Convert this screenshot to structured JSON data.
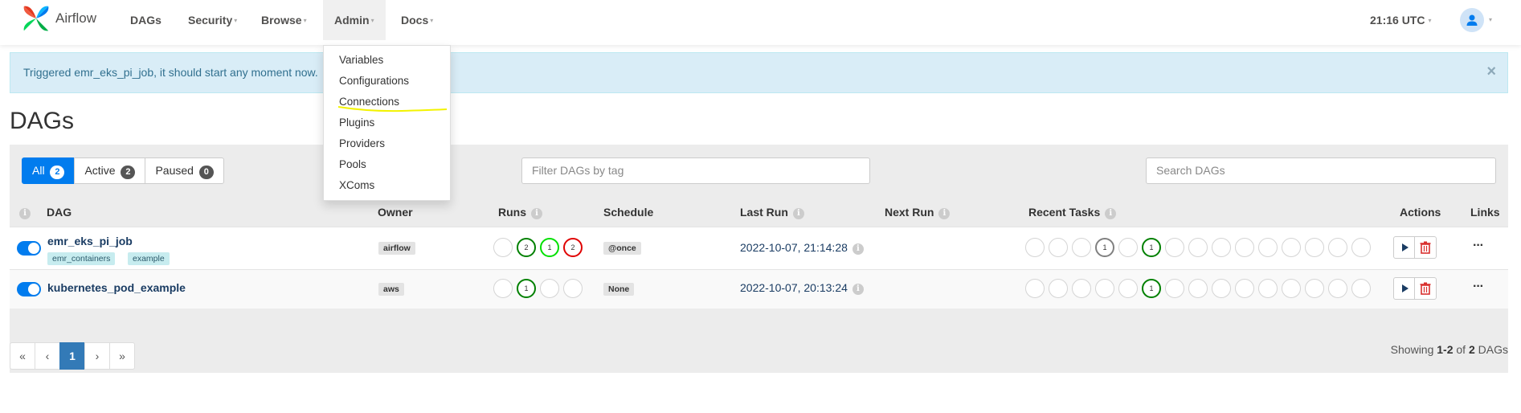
{
  "nav": {
    "brand": "Airflow",
    "items": [
      {
        "label": "DAGs"
      },
      {
        "label": "Security"
      },
      {
        "label": "Browse"
      },
      {
        "label": "Admin"
      },
      {
        "label": "Docs"
      }
    ],
    "clock": "21:16 UTC",
    "caret": "▾"
  },
  "admin_menu": {
    "items": [
      "Variables",
      "Configurations",
      "Connections",
      "Plugins",
      "Providers",
      "Pools",
      "XComs"
    ]
  },
  "alert": {
    "text": "Triggered emr_eks_pi_job, it should start any moment now.",
    "close": "×"
  },
  "page_title": "DAGs",
  "filters": {
    "all_label": "All",
    "all_count": "2",
    "active_label": "Active",
    "active_count": "2",
    "paused_label": "Paused",
    "paused_count": "0",
    "tag_placeholder": "Filter DAGs by tag",
    "search_placeholder": "Search DAGs"
  },
  "columns": {
    "dag": "DAG",
    "owner": "Owner",
    "runs": "Runs",
    "schedule": "Schedule",
    "last_run": "Last Run",
    "next_run": "Next Run",
    "recent_tasks": "Recent Tasks",
    "actions": "Actions",
    "links": "Links",
    "info": "i"
  },
  "dags": [
    {
      "dag_id": "emr_eks_pi_job",
      "tags": [
        "emr_containers",
        "example"
      ],
      "owner": "airflow",
      "runs": [
        {
          "count": "",
          "state": "none"
        },
        {
          "count": "2",
          "state": "success"
        },
        {
          "count": "1",
          "state": "running"
        },
        {
          "count": "2",
          "state": "failed"
        }
      ],
      "schedule": "@once",
      "last_run": "2022-10-07, 21:14:28",
      "recent_task_labels": {
        "idx3": "1",
        "idx5": "1"
      },
      "active": true
    },
    {
      "dag_id": "kubernetes_pod_example",
      "tags": [],
      "owner": "aws",
      "runs": [
        {
          "count": "",
          "state": "none"
        },
        {
          "count": "1",
          "state": "success"
        },
        {
          "count": "",
          "state": "none"
        },
        {
          "count": "",
          "state": "none"
        }
      ],
      "schedule": "None",
      "last_run": "2022-10-07, 20:13:24",
      "recent_task_labels": {
        "idx5": "1"
      },
      "active": true
    }
  ],
  "links_label": "···",
  "pagination": {
    "first": "«",
    "prev": "‹",
    "current": "1",
    "next": "›",
    "last": "»",
    "showing_prefix": "Showing ",
    "showing_range": "1-2",
    "showing_of": " of ",
    "showing_total": "2",
    "showing_suffix": " DAGs"
  },
  "colors": {
    "accent": "#017cee",
    "success": "#008000",
    "running": "#00e000",
    "failed": "#e00000",
    "queued": "#808080"
  }
}
